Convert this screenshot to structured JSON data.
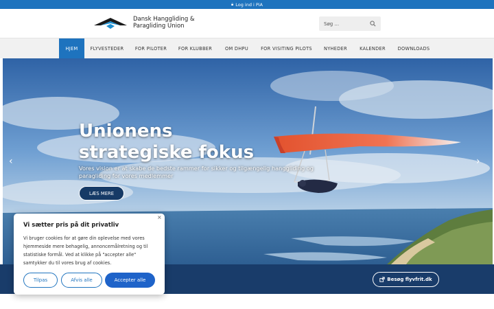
{
  "topbar": {
    "lock_icon": "lock-icon",
    "login_label": "Log ind i PiA"
  },
  "header": {
    "logo_line1": "Dansk Hanggliding &",
    "logo_line2": "Paragliding Union",
    "search_placeholder": "Søg ..."
  },
  "nav": {
    "items": [
      {
        "label": "HJEM",
        "active": true
      },
      {
        "label": "FLYVESTEDER"
      },
      {
        "label": "FOR PILOTER"
      },
      {
        "label": "FOR KLUBBER"
      },
      {
        "label": "OM DHPU"
      },
      {
        "label": "FOR VISITING PILOTS"
      },
      {
        "label": "NYHEDER"
      },
      {
        "label": "KALENDER"
      },
      {
        "label": "DOWNLOADS"
      }
    ]
  },
  "hero": {
    "title_line1": "Unionens",
    "title_line2": "strategiske fokus",
    "subtitle": "Vores vision er at skabe de bedste rammer for sikker og tilgængelig hanggliding og paragliding for vores medlemmer",
    "button": "LÆS MERE",
    "prev": "‹",
    "next": "›"
  },
  "band": {
    "visit_button": "Besøg flyvfrit.dk",
    "visit_icon": "external-link-icon"
  },
  "cookie": {
    "close": "×",
    "title": "Vi sætter pris på dit privatliv",
    "body": "Vi bruger cookies for at gøre din oplevelse med vores hjemmeside mere behagelig, annoncemålretning og til statistiske formål. Ved at klikke på \"accepter alle\" samtykker du til vores brug af cookies.",
    "customize": "Tilpas",
    "reject": "Afvis alle",
    "accept": "Accepter alle"
  },
  "colors": {
    "primary": "#1e73be",
    "dark_band": "#193c6a",
    "hero_button": "#163a66"
  }
}
